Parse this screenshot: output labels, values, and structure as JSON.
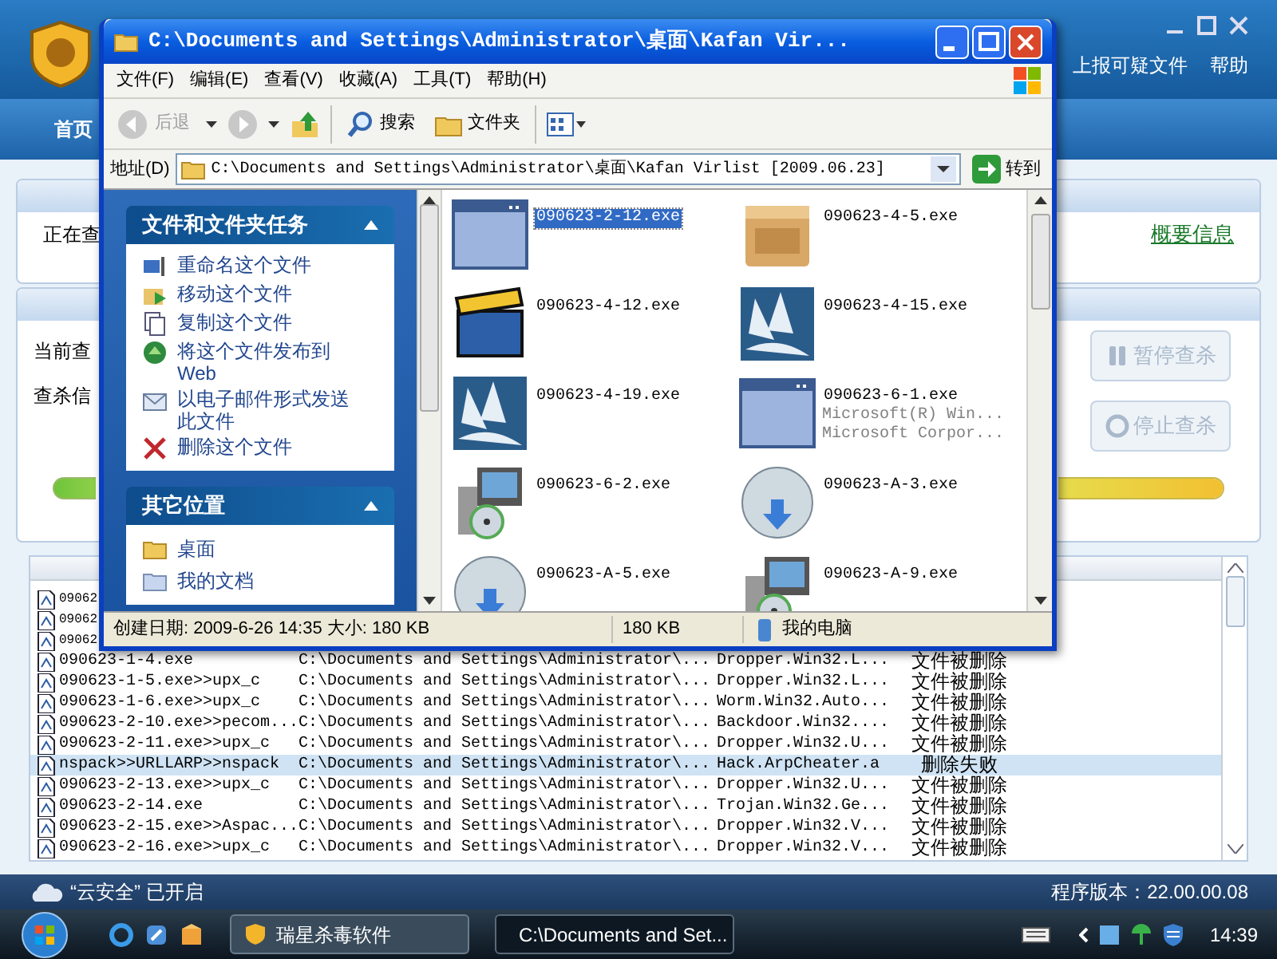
{
  "av_window": {
    "menu": [
      {
        "label": "上报可疑文件"
      },
      {
        "label": "帮助"
      }
    ],
    "nav_tabs": [
      {
        "label": "首页",
        "selected": true
      }
    ],
    "scan_panel": {
      "label": "正在查",
      "link": "概要信息"
    },
    "current_panel": {
      "labels": [
        "当前查",
        "查杀信"
      ],
      "progress": {
        "level": 1
      },
      "buttons": [
        {
          "kind": "pause",
          "label": "暂停查杀",
          "disabled": true
        },
        {
          "kind": "stop",
          "label": "停止查杀",
          "disabled": true
        }
      ]
    },
    "results": [
      {
        "name": "09062"
      },
      {
        "name": "09062"
      },
      {
        "name": "09062"
      },
      {
        "name": "090623-1-4.exe",
        "path": "C:\\Documents and Settings\\Administrator\\...",
        "virus": "Dropper.Win32.L...",
        "result": "文件被删除",
        "selected": false
      },
      {
        "name": "090623-1-5.exe>>upx_c",
        "path": "C:\\Documents and Settings\\Administrator\\...",
        "virus": "Dropper.Win32.L...",
        "result": "文件被删除",
        "selected": false
      },
      {
        "name": "090623-1-6.exe>>upx_c",
        "path": "C:\\Documents and Settings\\Administrator\\...",
        "virus": "Worm.Win32.Auto...",
        "result": "文件被删除",
        "selected": false
      },
      {
        "name": "090623-2-10.exe>>pecom...",
        "path": "C:\\Documents and Settings\\Administrator\\...",
        "virus": "Backdoor.Win32....",
        "result": "文件被删除",
        "selected": false
      },
      {
        "name": "090623-2-11.exe>>upx_c",
        "path": "C:\\Documents and Settings\\Administrator\\...",
        "virus": "Dropper.Win32.U...",
        "result": "文件被删除",
        "selected": false
      },
      {
        "name": "nspack>>URLLARP>>nspack",
        "path": "C:\\Documents and Settings\\Administrator\\...",
        "virus": "Hack.ArpCheater.a",
        "result": "删除失败",
        "selected": true
      },
      {
        "name": "090623-2-13.exe>>upx_c",
        "path": "C:\\Documents and Settings\\Administrator\\...",
        "virus": "Dropper.Win32.U...",
        "result": "文件被删除",
        "selected": false
      },
      {
        "name": "090623-2-14.exe",
        "path": "C:\\Documents and Settings\\Administrator\\...",
        "virus": "Trojan.Win32.Ge...",
        "result": "文件被删除",
        "selected": false
      },
      {
        "name": "090623-2-15.exe>>Aspac...",
        "path": "C:\\Documents and Settings\\Administrator\\...",
        "virus": "Dropper.Win32.V...",
        "result": "文件被删除",
        "selected": false
      },
      {
        "name": "090623-2-16.exe>>upx_c",
        "path": "C:\\Documents and Settings\\Administrator\\...",
        "virus": "Dropper.Win32.V...",
        "result": "文件被删除",
        "selected": false
      }
    ],
    "status_bar": {
      "cloud": "“云安全” 已开启",
      "version": "程序版本：22.00.00.08"
    }
  },
  "explorer": {
    "title": "C:\\Documents and Settings\\Administrator\\桌面\\Kafan Vir...",
    "menu": [
      "文件(F)",
      "编辑(E)",
      "查看(V)",
      "收藏(A)",
      "工具(T)",
      "帮助(H)"
    ],
    "toolbar": {
      "back": {
        "label": "后退",
        "disabled": true
      },
      "search": "搜索",
      "folders": "文件夹"
    },
    "address": {
      "label": "地址(D)",
      "value": "C:\\Documents and Settings\\Administrator\\桌面\\Kafan Virlist [2009.06.23]",
      "go": "转到"
    },
    "tasks_panel": {
      "title": "文件和文件夹任务",
      "expanded": true,
      "items": [
        {
          "kind": "rename",
          "label": "重命名这个文件"
        },
        {
          "kind": "move",
          "label": "移动这个文件"
        },
        {
          "kind": "copy",
          "label": "复制这个文件"
        },
        {
          "kind": "publish",
          "label": "将这个文件发布到 Web"
        },
        {
          "kind": "email",
          "label": "以电子邮件形式发送此文件"
        },
        {
          "kind": "delete",
          "label": "删除这个文件"
        }
      ]
    },
    "places_panel": {
      "title": "其它位置",
      "expanded": true,
      "items": [
        {
          "kind": "folder",
          "label": "桌面"
        },
        {
          "kind": "documents",
          "label": "我的文档"
        }
      ]
    },
    "files": [
      {
        "kind": "window",
        "name": "090623-2-12.exe",
        "selected": true
      },
      {
        "kind": "box",
        "name": "090623-4-5.exe",
        "selected": false
      },
      {
        "kind": "clapper",
        "name": "090623-4-12.exe",
        "selected": false
      },
      {
        "kind": "sail",
        "name": "090623-4-15.exe",
        "selected": false
      },
      {
        "kind": "sail",
        "name": "090623-4-19.exe",
        "selected": false
      },
      {
        "kind": "window",
        "name": "090623-6-1.exe",
        "details": [
          "Microsoft(R) Win...",
          "Microsoft Corpor..."
        ],
        "selected": false
      },
      {
        "kind": "installer",
        "name": "090623-6-2.exe",
        "selected": false
      },
      {
        "kind": "nsis",
        "name": "090623-A-3.exe",
        "selected": false
      },
      {
        "kind": "nsis",
        "name": "090623-A-5.exe",
        "selected": false
      },
      {
        "kind": "installer",
        "name": "090623-A-9.exe",
        "selected": false
      }
    ],
    "status_bar": {
      "details": "创建日期: 2009-6-26 14:35 大小: 180 KB",
      "size": "180 KB",
      "zone": "我的电脑"
    }
  },
  "taskbar": {
    "tasks": [
      {
        "kind": "antivirus",
        "label": "瑞星杀毒软件",
        "selected": false
      },
      {
        "kind": "folder",
        "label": "C:\\Documents and Set...",
        "selected": true
      }
    ],
    "clock": "14:39"
  }
}
